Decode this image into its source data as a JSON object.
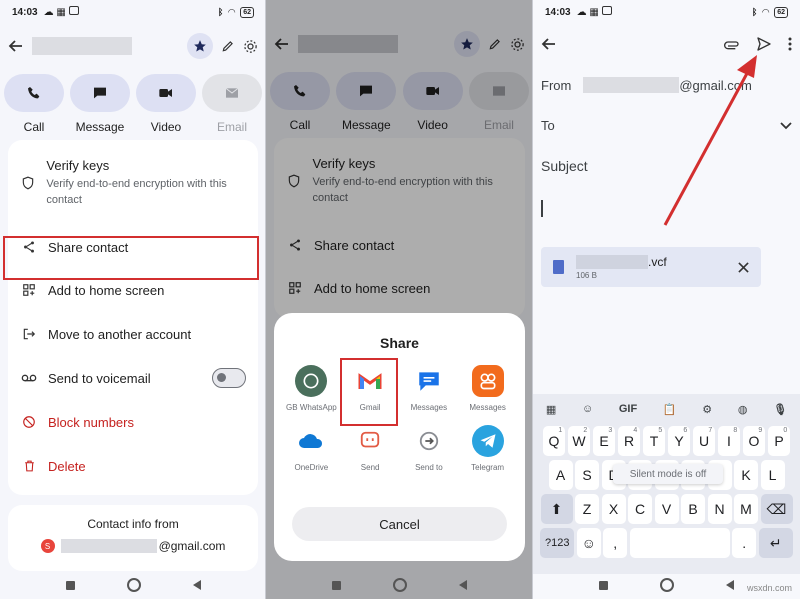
{
  "status": {
    "time": "14:03",
    "battery": "62"
  },
  "contact": {
    "actions": [
      {
        "label": "Call",
        "icon": "phone-icon"
      },
      {
        "label": "Message",
        "icon": "message-icon"
      },
      {
        "label": "Video",
        "icon": "video-icon"
      },
      {
        "label": "Email",
        "icon": "email-icon"
      }
    ],
    "verify_title": "Verify keys",
    "verify_sub": "Verify end-to-end encryption with this contact",
    "share_contact": "Share contact",
    "add_home": "Add to home screen",
    "move_account": "Move to another account",
    "voicemail": "Send to voicemail",
    "block": "Block numbers",
    "delete": "Delete",
    "contact_info_from": "Contact info from",
    "avatar_letter": "S",
    "email_domain": "@gmail.com"
  },
  "share": {
    "title": "Share",
    "apps": [
      {
        "label": "GB WhatsApp",
        "icon": "gb-whatsapp-icon",
        "color": "#4a6f5c"
      },
      {
        "label": "Gmail",
        "icon": "gmail-icon",
        "color": "#ffffff"
      },
      {
        "label": "Messages",
        "icon": "messages-icon",
        "color": "#1a73e8"
      },
      {
        "label": "Messages",
        "icon": "messages-alt-icon",
        "color": "#f26b1d"
      },
      {
        "label": "OneDrive",
        "icon": "onedrive-icon",
        "color": "#ffffff"
      },
      {
        "label": "Send",
        "icon": "send-app-icon",
        "color": "#ffffff"
      },
      {
        "label": "Send to",
        "icon": "send-to-icon",
        "color": "#ffffff"
      },
      {
        "label": "Telegram",
        "icon": "telegram-icon",
        "color": "#2aa3df"
      }
    ],
    "cancel": "Cancel"
  },
  "compose": {
    "from_label": "From",
    "from_domain": "@gmail.com",
    "to_label": "To",
    "subject_label": "Subject",
    "attachment_ext": ".vcf",
    "attachment_size": "106 B"
  },
  "keyboard": {
    "row1": [
      "q",
      "w",
      "e",
      "r",
      "t",
      "y",
      "u",
      "i",
      "o",
      "p"
    ],
    "row1_sup": [
      "1",
      "2",
      "3",
      "4",
      "5",
      "6",
      "7",
      "8",
      "9",
      "0"
    ],
    "row2": [
      "a",
      "s",
      "d",
      "f",
      "g",
      "h",
      "j",
      "k",
      "l"
    ],
    "row3": [
      "z",
      "x",
      "c",
      "v",
      "b",
      "n",
      "m"
    ],
    "gif": "GIF",
    "num": "?123",
    "comma": ",",
    "period": ".",
    "toast": "Silent mode is off"
  },
  "watermark": "wsxdn.com",
  "colors": {
    "highlight": "#d32f2f",
    "arrow": "#d32f2f"
  }
}
